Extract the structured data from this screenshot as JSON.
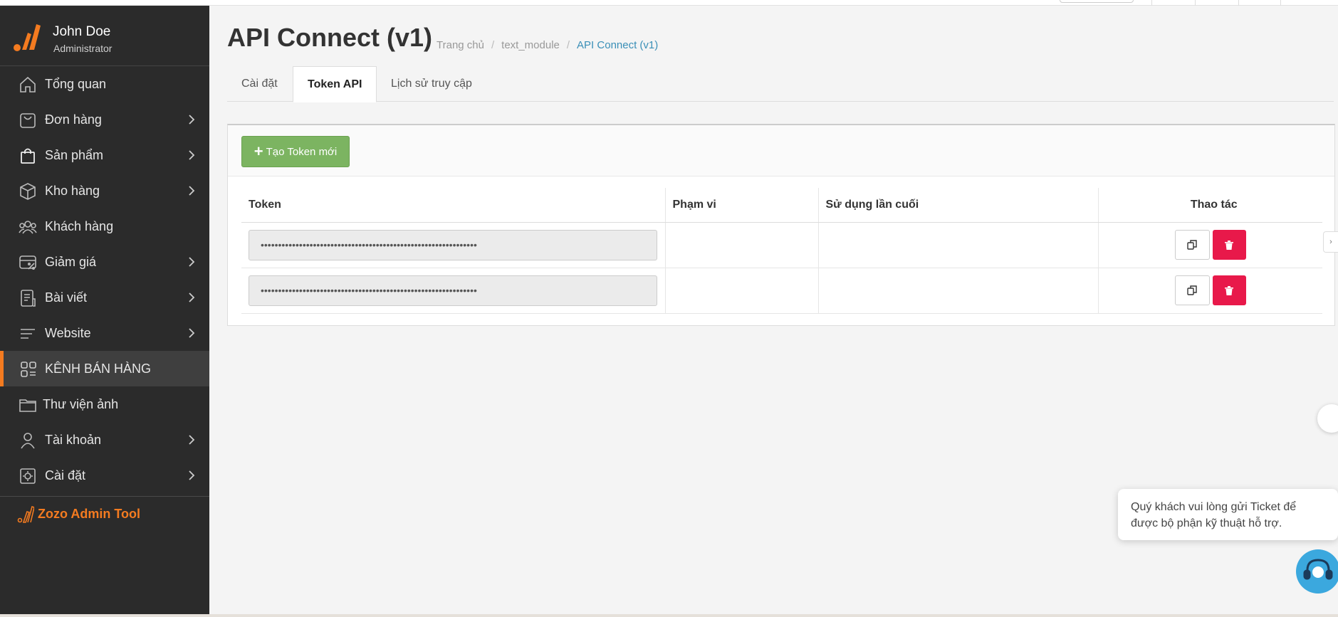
{
  "user": {
    "name": "John Doe",
    "role": "Administrator"
  },
  "sidebar": {
    "items": [
      {
        "label": "Tổng quan",
        "icon": "home-icon",
        "has_children": false
      },
      {
        "label": "Đơn hàng",
        "icon": "shopping-bag-icon",
        "has_children": true
      },
      {
        "label": "Sản phẩm",
        "icon": "bag-icon",
        "has_children": true
      },
      {
        "label": "Kho hàng",
        "icon": "box-icon",
        "has_children": true
      },
      {
        "label": "Khách hàng",
        "icon": "users-icon",
        "has_children": false
      },
      {
        "label": "Giảm giá",
        "icon": "discount-icon",
        "has_children": true
      },
      {
        "label": "Bài viết",
        "icon": "document-icon",
        "has_children": true
      },
      {
        "label": "Website",
        "icon": "lines-icon",
        "has_children": true
      },
      {
        "label": "KÊNH BÁN HÀNG",
        "icon": "grid-icon",
        "has_children": false,
        "active": true
      },
      {
        "label": "Thư viện ảnh",
        "icon": "folder-icon",
        "has_children": false
      },
      {
        "label": "Tài khoản",
        "icon": "person-icon",
        "has_children": true
      },
      {
        "label": "Cài đặt",
        "icon": "settings-icon",
        "has_children": true
      }
    ],
    "tool_label": "Zozo Admin Tool"
  },
  "header": {
    "title": "API Connect (v1)",
    "breadcrumb": [
      "Trang chủ",
      "text_module",
      "API Connect (v1)"
    ]
  },
  "tabs": [
    {
      "label": "Cài đặt",
      "active": false
    },
    {
      "label": "Token API",
      "active": true
    },
    {
      "label": "Lịch sử truy cập",
      "active": false
    }
  ],
  "toolbar": {
    "new_token_label": "Tạo Token mới"
  },
  "table": {
    "headers": {
      "token": "Token",
      "scope": "Phạm vi",
      "last_used": "Sử dụng lần cuối",
      "actions": "Thao tác"
    },
    "rows": [
      {
        "token": "••••••••••••••••••••••••••••••••••••••••••••••••••••••••••••••",
        "scope": "",
        "last_used": ""
      },
      {
        "token": "••••••••••••••••••••••••••••••••••••••••••••••••••••••••••••••",
        "scope": "",
        "last_used": ""
      }
    ]
  },
  "chat": {
    "message": "Quý khách vui lòng gửi Ticket để được bộ phận kỹ thuật hỗ trợ."
  },
  "colors": {
    "sidebar_bg": "#2b2b2b",
    "accent": "#f47b20",
    "success": "#7cb461",
    "danger": "#e8194a",
    "link": "#3a8fb7"
  }
}
